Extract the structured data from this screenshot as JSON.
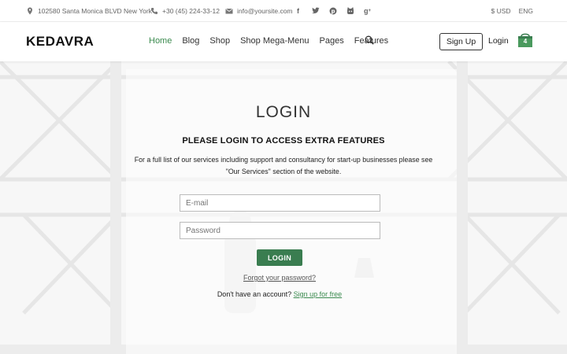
{
  "topbar": {
    "address": "102580 Santa Monica BLVD New York",
    "phone": "+30 (45) 224-33-12",
    "email": "info@yoursite.com",
    "social": [
      "facebook-icon",
      "twitter-icon",
      "pinterest-icon",
      "github-icon",
      "google-plus-icon"
    ],
    "currency": "$ USD",
    "language": "ENG"
  },
  "header": {
    "logo": "KEDAVRA",
    "nav": [
      "Home",
      "Blog",
      "Shop",
      "Shop Mega-Menu",
      "Pages",
      "Features"
    ],
    "signup": "Sign Up",
    "login": "Login",
    "cart_count": "4"
  },
  "login": {
    "title": "LOGIN",
    "subtitle": "PLEASE LOGIN TO ACCESS EXTRA FEATURES",
    "desc_line1": "For a full list of our services including support and consultancy for start-up businesses please see",
    "desc_line2": "\"Our Services\" section of the website.",
    "email_placeholder": "E-mail",
    "password_placeholder": "Password",
    "button": "LOGIN",
    "forgot": "Forgot your password?",
    "no_account": "Don't have an account?",
    "signup_link": "Sign up for free"
  },
  "colors": {
    "accent": "#3a8a4e",
    "button": "#3a7d50"
  }
}
